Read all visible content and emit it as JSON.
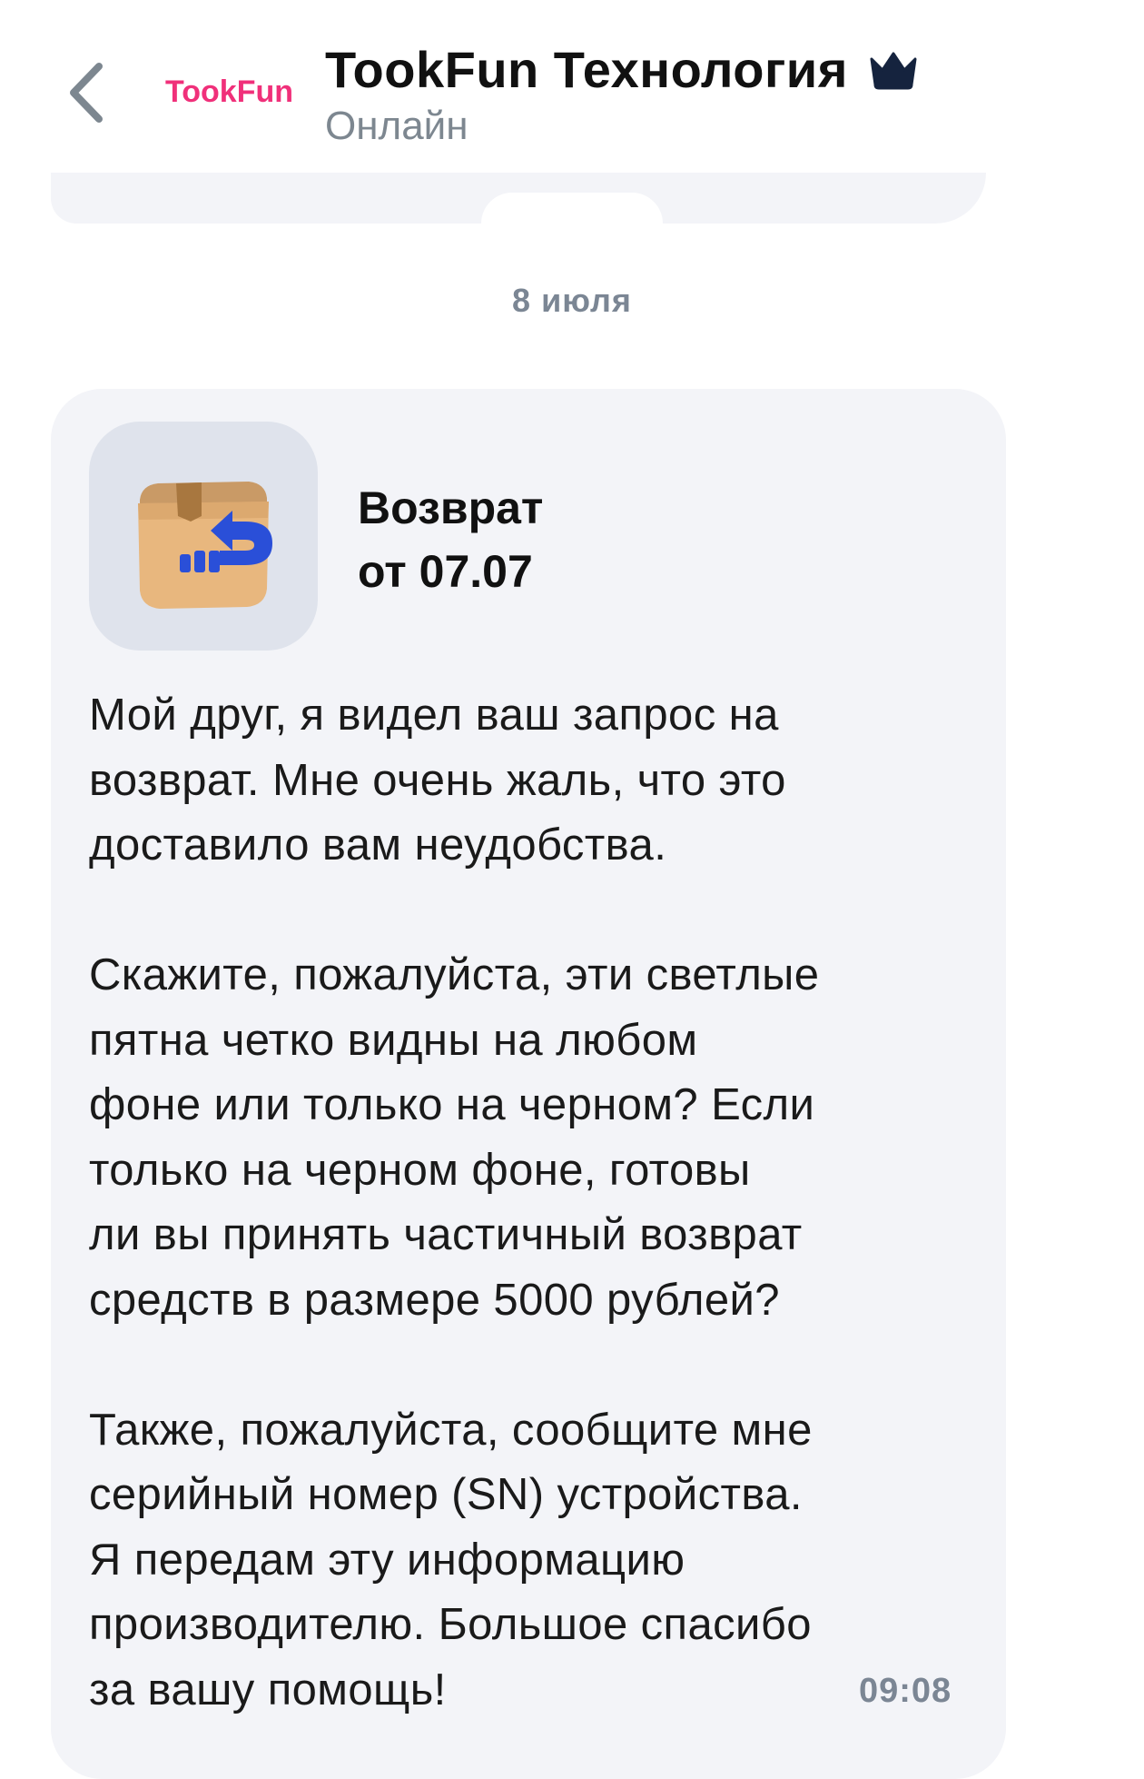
{
  "header": {
    "brand_logo_text": "TookFun",
    "title": "TookFun Технология",
    "status": "Онлайн",
    "icons": {
      "back": "chevron-left-icon",
      "verified": "crown-icon"
    }
  },
  "chat": {
    "date_separator": "8 июля",
    "message": {
      "card": {
        "icon": "return-box-icon",
        "title_line1": "Возврат",
        "title_line2": "от 07.07"
      },
      "text": "Мой друг, я видел ваш запрос на\nвозврат. Мне очень жаль, что это\nдоставило вам неудобства.\n\nСкажите, пожалуйста, эти светлые\nпятна четко видны на любом\nфоне или только на черном? Если\nтолько на черном фоне, готовы\nли вы принять частичный возврат\nсредств в размере 5000 рублей?\n\nТакже, пожалуйста, сообщите мне\nсерийный номер (SN) устройства.\nЯ передам эту информацию\nпроизводителю. Большое спасибо\nза вашу помощь!",
      "time": "09:08"
    }
  },
  "colors": {
    "bubble_bg": "#f3f4f8",
    "icon_tile_bg": "#dfe3ec",
    "muted_text": "#7b8694",
    "brand_pink": "#f0307a",
    "brand_blue": "#2a4fd8"
  }
}
